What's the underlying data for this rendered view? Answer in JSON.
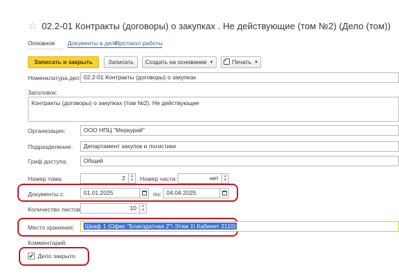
{
  "header": {
    "title": "02.2-01 Контракты (договоры) о закупках . Не действующие (том №2) (Дело (том))",
    "star_icon": "star-icon"
  },
  "tabs": [
    {
      "label": "Основное"
    },
    {
      "label": "Документы в деле"
    },
    {
      "label": "Протокол работы"
    }
  ],
  "toolbar": {
    "save_close": "Записать и закрыть",
    "save": "Записать",
    "create_based": "Создать на основании",
    "print": "Печать"
  },
  "form": {
    "nomenclature_label": "Номенклатура дел:",
    "nomenclature_value": "02.2-01 Контракты (договоры) о закупках",
    "heading_label": "Заголовок:",
    "heading_value": "Контракты (договоры) о закупках (том №2). Не действующие",
    "organization_label": "Организация:",
    "organization_value": "ООО НПЦ \"Меркурий\"",
    "department_label": "Подразделение:",
    "department_value": "Департамент закупок и логистики",
    "access_label": "Гриф доступа:",
    "access_value": "Общий",
    "volume_label": "Номер тома:",
    "volume_value": "2",
    "part_label": "Номер части:",
    "part_value": "нет",
    "docs_from_label": "Документы с:",
    "docs_from_value": "01.01.2025",
    "docs_to_label": "по:",
    "docs_to_value": "04.04.2025",
    "sheets_label": "Количество листов:",
    "sheets_value": "10",
    "storage_label": "Место хранения:",
    "storage_value": "Шкаф 1 (Офис \"Благодатная 2\"\\ Этаж 1\\ Кабинет 2110)",
    "comment_label": "Комментарий:",
    "closed_label": "Дело закрыто",
    "closed_checked": true
  },
  "colors": {
    "accent_yellow": "#fbd32d",
    "highlight_red": "#c9141e",
    "link_blue": "#355e9e",
    "selection_blue": "#3d6fd1"
  }
}
